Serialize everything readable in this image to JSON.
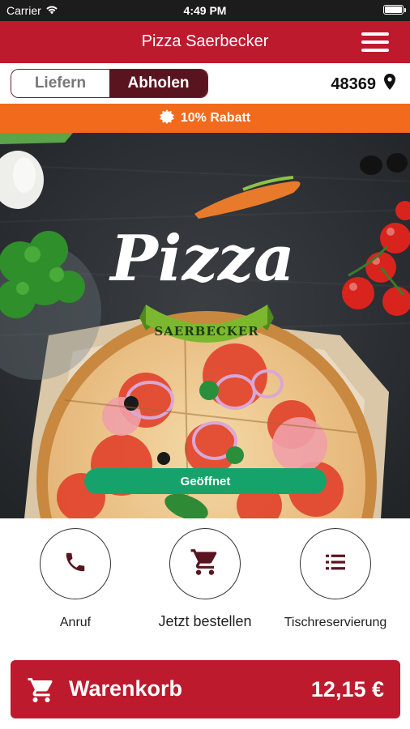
{
  "status_bar": {
    "carrier": "Carrier",
    "time": "4:49 PM",
    "battery_level": 1.0
  },
  "header": {
    "title": "Pizza Saerbecker",
    "menu_icon": "hamburger-menu-icon"
  },
  "mode_toggle": {
    "options": [
      {
        "label": "Liefern",
        "selected": false
      },
      {
        "label": "Abholen",
        "selected": true
      }
    ]
  },
  "location": {
    "postal_code": "48369",
    "icon": "location-pin-icon"
  },
  "promo": {
    "text": "10% Rabatt",
    "icon": "badge-icon"
  },
  "hero": {
    "logo_text": "Pizza",
    "logo_ribbon": "SAERBECKER",
    "status_label": "Geöffnet"
  },
  "actions": [
    {
      "label": "Anruf",
      "icon": "phone-icon"
    },
    {
      "label": "Jetzt bestellen",
      "icon": "shopping-cart-icon"
    },
    {
      "label": "Tischreservierung",
      "icon": "list-icon"
    }
  ],
  "cart": {
    "label": "Warenkorb",
    "total": "12,15 €",
    "icon": "shopping-cart-icon"
  },
  "colors": {
    "brand_red": "#bd1a2e",
    "dark_maroon": "#5a1420",
    "promo_orange": "#f26a1b",
    "open_green": "#16a36b"
  }
}
